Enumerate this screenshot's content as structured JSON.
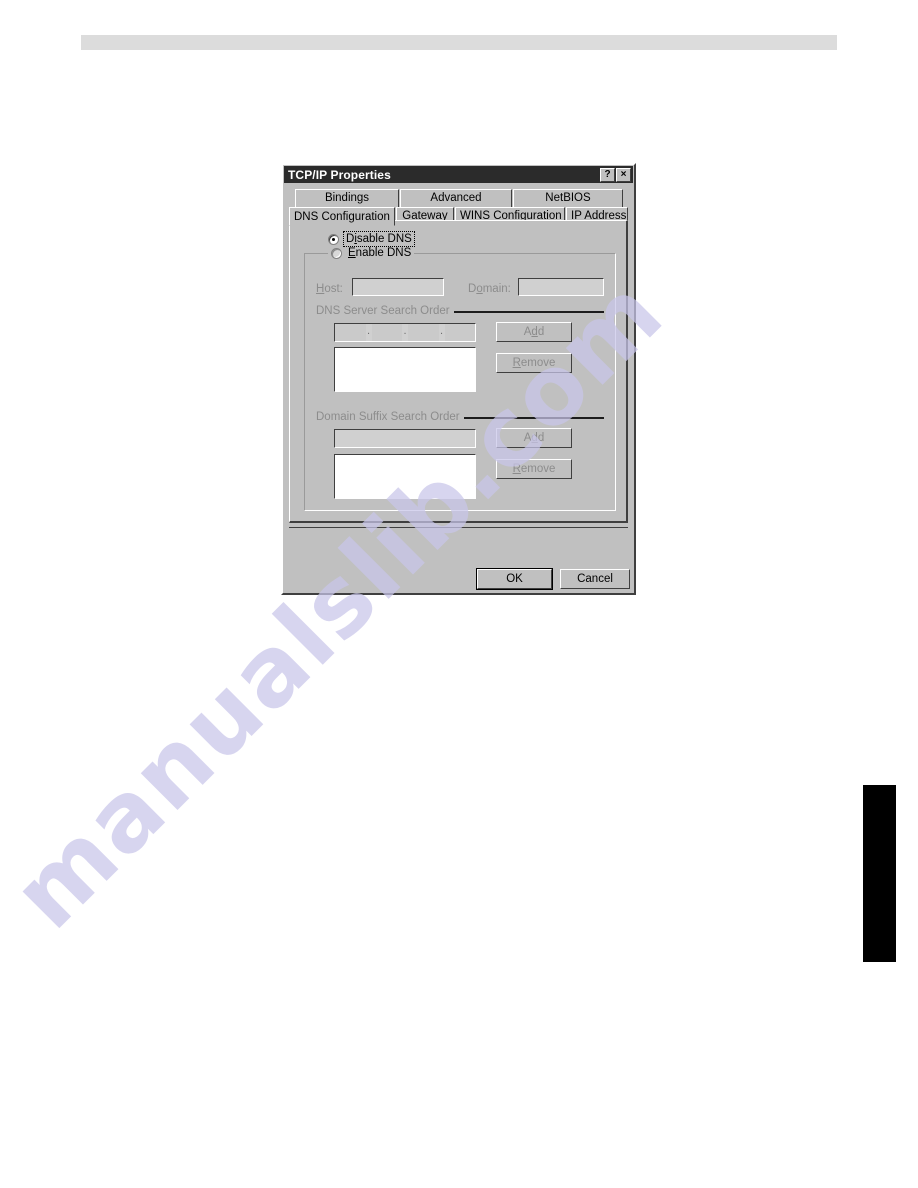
{
  "page": {
    "watermark_text": "manualslib.com"
  },
  "dialog": {
    "title": "TCP/IP Properties",
    "help_button": "?",
    "close_button": "×",
    "tabs_row1": [
      {
        "label": "Bindings",
        "active": false
      },
      {
        "label": "Advanced",
        "active": false
      },
      {
        "label": "NetBIOS",
        "active": false
      }
    ],
    "tabs_row2": [
      {
        "label": "DNS Configuration",
        "active": true
      },
      {
        "label": "Gateway",
        "active": false
      },
      {
        "label": "WINS Configuration",
        "active": false
      },
      {
        "label": "IP Address",
        "active": false
      }
    ],
    "radios": {
      "disable_prefix": "D",
      "disable_acc": "i",
      "disable_suffix": "sable DNS",
      "enable_acc": "E",
      "enable_suffix": "nable DNS"
    },
    "host_label": "Host:",
    "host_acc": "H",
    "host_value": "",
    "domain_label": "Domain:",
    "domain_acc": "o",
    "domain_value": "",
    "dns_section_title": "DNS Server Search Order",
    "dns_ip_value": "",
    "dns_ip_dot": ".",
    "dns_list_items": [],
    "dns_add_label": "Add",
    "dns_add_acc": "d",
    "dns_remove_label": "Remove",
    "dns_remove_acc": "R",
    "suffix_section_title": "Domain Suffix Search Order",
    "suffix_input_value": "",
    "suffix_list_items": [],
    "suffix_add_label": "Add",
    "suffix_add_acc": "d",
    "suffix_remove_label": "Remove",
    "suffix_remove_acc": "R",
    "ok_label": "OK",
    "cancel_label": "Cancel"
  }
}
